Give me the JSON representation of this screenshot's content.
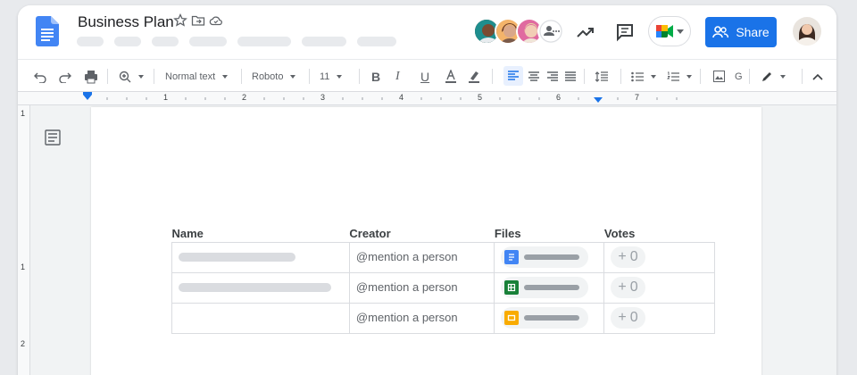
{
  "document": {
    "title": "Business Plan"
  },
  "header": {
    "share_label": "Share"
  },
  "toolbar": {
    "style_label": "Normal text",
    "font_label": "Roboto",
    "size_label": "11"
  },
  "ruler": {
    "marks": [
      "1",
      "2",
      "3",
      "4",
      "5",
      "6",
      "7"
    ],
    "vmarks": [
      "1",
      "1",
      "2"
    ]
  },
  "table": {
    "headers": [
      "Name",
      "Creator",
      "Files",
      "Votes"
    ],
    "rows": [
      {
        "creator": "@mention a person",
        "file_type": "docs",
        "votes": "0"
      },
      {
        "creator": "@mention a person",
        "file_type": "sheets",
        "votes": "0"
      },
      {
        "creator": "@mention a person",
        "file_type": "slides",
        "votes": "0"
      }
    ]
  },
  "colors": {
    "accent": "#1a73e8",
    "docs": "#4285f4",
    "sheets": "#188038",
    "slides": "#f9ab00"
  }
}
